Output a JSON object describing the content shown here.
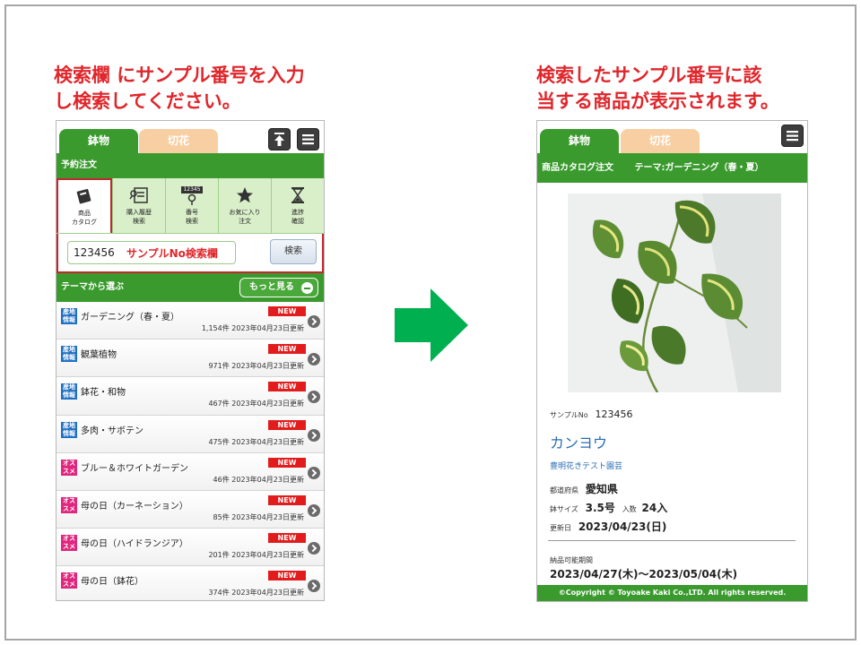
{
  "captions": {
    "left_line1": "検索欄 にサンプル番号を入力",
    "left_line2": "し検索してください。",
    "right_line1": "検索したサンプル番号に該",
    "right_line2": "当する商品が表示されます。"
  },
  "left_phone": {
    "tabs": [
      "鉢物",
      "切花"
    ],
    "sub_header": "予約注文",
    "icons": [
      {
        "icon": "catalog-book-icon",
        "label1": "商品",
        "label2": "カタログ"
      },
      {
        "icon": "purchase-history-icon",
        "label1": "購入履歴",
        "label2": "検索"
      },
      {
        "icon": "number-search-icon",
        "label1": "番号",
        "label2": "検索",
        "mini": "12345"
      },
      {
        "icon": "star-icon",
        "label1": "お気に入り",
        "label2": "注文"
      },
      {
        "icon": "hourglass-icon",
        "label1": "進捗",
        "label2": "確認"
      }
    ],
    "search": {
      "value": "123456",
      "hint": "サンプルNo検索欄",
      "button": "検索"
    },
    "theme_header": "テーマから選ぶ",
    "more_button": "もっと見る",
    "items": [
      {
        "tag": [
          "産地",
          "情報"
        ],
        "tag_color": "blue",
        "title": "ガーデニング（春・夏）",
        "badge": "NEW",
        "meta": "1,154件 2023年04月23日更新"
      },
      {
        "tag": [
          "産地",
          "情報"
        ],
        "tag_color": "blue",
        "title": "観葉植物",
        "badge": "NEW",
        "meta": "971件 2023年04月23日更新"
      },
      {
        "tag": [
          "産地",
          "情報"
        ],
        "tag_color": "blue",
        "title": "鉢花・和物",
        "badge": "NEW",
        "meta": "467件 2023年04月23日更新"
      },
      {
        "tag": [
          "産地",
          "情報"
        ],
        "tag_color": "blue",
        "title": "多肉・サボテン",
        "badge": "NEW",
        "meta": "475件 2023年04月23日更新"
      },
      {
        "tag": [
          "オス",
          "スメ"
        ],
        "tag_color": "pink",
        "title": "ブルー＆ホワイトガーデン",
        "badge": "NEW",
        "meta": "46件 2023年04月23日更新"
      },
      {
        "tag": [
          "オス",
          "スメ"
        ],
        "tag_color": "pink",
        "title": "母の日（カーネーション）",
        "badge": "NEW",
        "meta": "85件 2023年04月23日更新"
      },
      {
        "tag": [
          "オス",
          "スメ"
        ],
        "tag_color": "pink",
        "title": "母の日（ハイドランジア）",
        "badge": "NEW",
        "meta": "201件 2023年04月23日更新"
      },
      {
        "tag": [
          "オス",
          "スメ"
        ],
        "tag_color": "pink",
        "title": "母の日（鉢花）",
        "badge": "NEW",
        "meta": "374件 2023年04月23日更新"
      }
    ]
  },
  "right_phone": {
    "tabs": [
      "鉢物",
      "切花"
    ],
    "header_title": "商品カタログ注文",
    "header_theme": "テーマ:ガーデニング（春・夏）",
    "sample_label": "サンプルNo",
    "sample_value": "123456",
    "product_name": "カンヨウ",
    "nursery": "豊明花きテスト園芸",
    "pref_label": "都道府県",
    "pref_value": "愛知県",
    "pot_label": "鉢サイズ",
    "pot_value": "3.5号",
    "qty_label": "入数",
    "qty_value": "24入",
    "updated_label": "更新日",
    "updated_value": "2023/04/23(日)",
    "delivery_label": "納品可能期間",
    "delivery_value": "2023/04/27(木)～2023/05/04(木)",
    "footer": "©Copyright © Toyoake Kaki Co.,LTD. All rights reserved."
  },
  "colors": {
    "brand_green": "#3a9a2e",
    "highlight_red": "#c4262e",
    "arrow_green": "#00b050",
    "caption_red": "#e0262b"
  }
}
